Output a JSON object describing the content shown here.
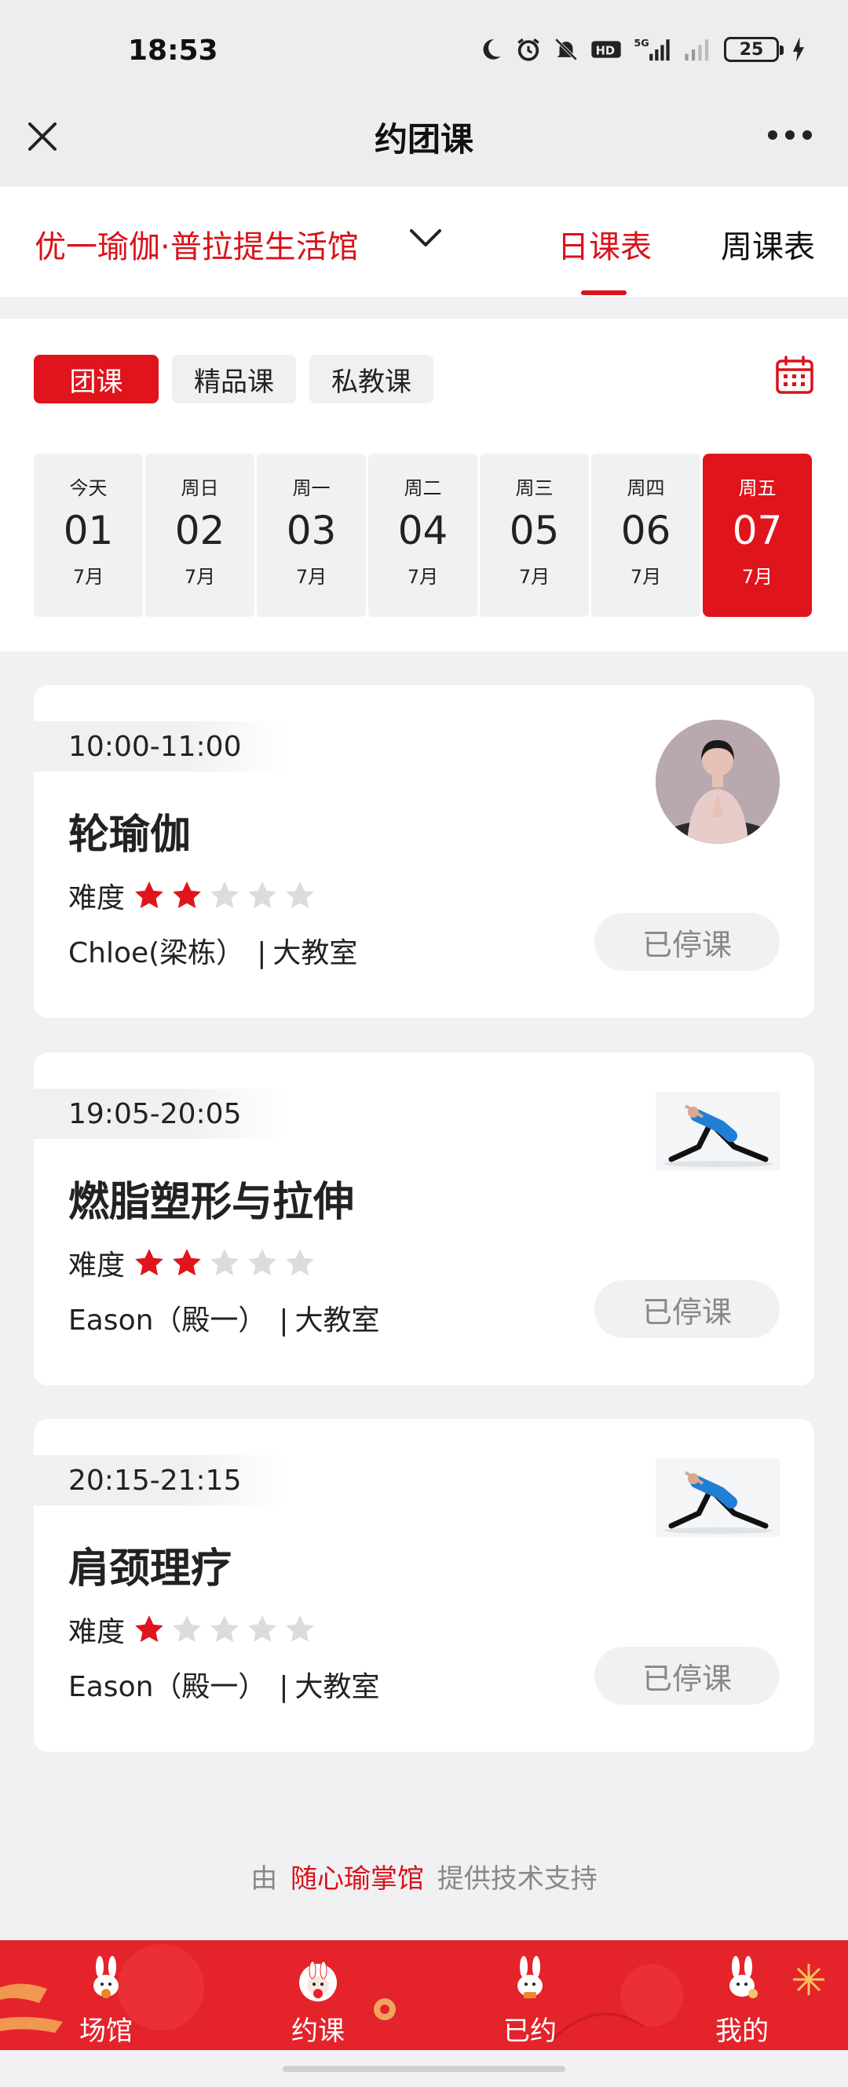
{
  "status_bar": {
    "time": "18:53",
    "battery": "25",
    "icons": [
      "moon-icon",
      "alarm-icon",
      "mute-icon",
      "hd-icon",
      "signal-5g-icon",
      "signal-icon"
    ]
  },
  "nav": {
    "title": "约团课",
    "close_icon": "close-icon",
    "more_icon": "more-icon"
  },
  "store": {
    "name": "优一瑜伽·普拉提生活馆",
    "tabs": [
      {
        "label": "日课表",
        "active": true
      },
      {
        "label": "周课表",
        "active": false
      }
    ]
  },
  "filters": {
    "chips": [
      {
        "label": "团课",
        "active": true
      },
      {
        "label": "精品课",
        "active": false
      },
      {
        "label": "私教课",
        "active": false
      }
    ],
    "calendar_icon": "calendar-icon"
  },
  "dates": [
    {
      "weekday": "今天",
      "day": "01",
      "month": "7月",
      "selected": false
    },
    {
      "weekday": "周日",
      "day": "02",
      "month": "7月",
      "selected": false
    },
    {
      "weekday": "周一",
      "day": "03",
      "month": "7月",
      "selected": false
    },
    {
      "weekday": "周二",
      "day": "04",
      "month": "7月",
      "selected": false
    },
    {
      "weekday": "周三",
      "day": "05",
      "month": "7月",
      "selected": false
    },
    {
      "weekday": "周四",
      "day": "06",
      "month": "7月",
      "selected": false
    },
    {
      "weekday": "周五",
      "day": "07",
      "month": "7月",
      "selected": true
    }
  ],
  "classes": [
    {
      "time": "10:00-11:00",
      "title": "轮瑜伽",
      "difficulty_label": "难度",
      "difficulty": 2,
      "difficulty_max": 5,
      "teacher": "Chloe(梁栋）",
      "room": "大教室",
      "status": "已停课"
    },
    {
      "time": "19:05-20:05",
      "title": "燃脂塑形与拉伸",
      "difficulty_label": "难度",
      "difficulty": 2,
      "difficulty_max": 5,
      "teacher": "Eason（殿一）",
      "room": "大教室",
      "status": "已停课"
    },
    {
      "time": "20:15-21:15",
      "title": "肩颈理疗",
      "difficulty_label": "难度",
      "difficulty": 1,
      "difficulty_max": 5,
      "teacher": "Eason（殿一）",
      "room": "大教室",
      "status": "已停课"
    }
  ],
  "footer": {
    "prefix": "由",
    "brand": "随心瑜掌馆",
    "suffix": "提供技术支持"
  },
  "bottom_tabs": [
    {
      "label": "场馆"
    },
    {
      "label": "约课"
    },
    {
      "label": "已约"
    },
    {
      "label": "我的"
    }
  ],
  "colors": {
    "accent": "#e0141c",
    "tab_bar": "#e5232b",
    "star_off": "#dcdcdc"
  }
}
